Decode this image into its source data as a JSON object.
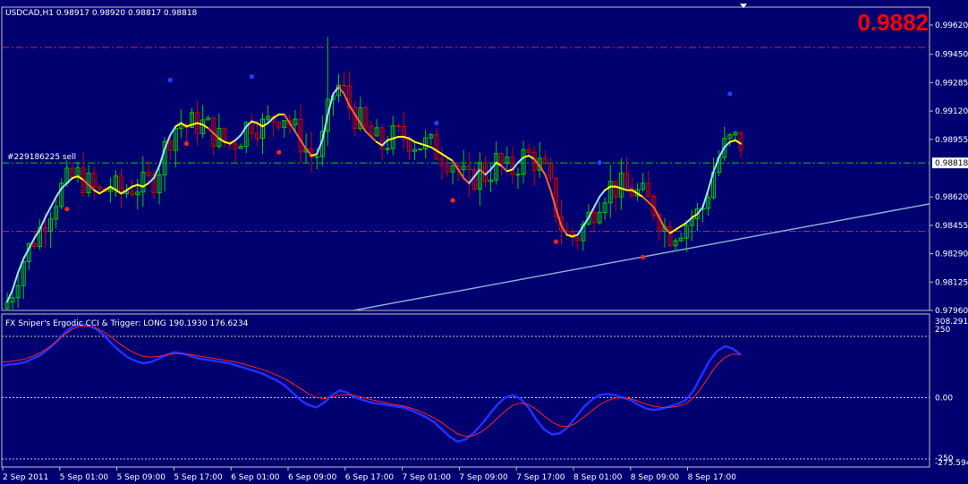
{
  "main": {
    "header": "USDCAD,H1  0.98917 0.98920 0.98817 0.98818",
    "big_price": "0.9882",
    "order_label": "#229186225 sell",
    "current_price_tag": "0.98818"
  },
  "indicator": {
    "header": "FX Sniper's Ergodic CCI & Trigger: LONG 190.1930 176.6234"
  },
  "colors": {
    "background": "#000070",
    "bull_candle": "#00cc00",
    "bear_candle": "#cc0000",
    "ma_up": "#9fe0ff",
    "ma_flat": "#ffff00",
    "ma_down": "#ff6030",
    "red_level": "#e02020",
    "green_level": "#00cc00",
    "trend_line": "#8aa9d6",
    "cci": "#2030ff",
    "trigger": "#ff2020"
  },
  "chart_data": [
    {
      "type": "candlestick",
      "title": "USDCAD,H1",
      "y_ticks": [
        "0.99620",
        "0.99450",
        "0.99285",
        "0.99120",
        "0.98955",
        "0.98818",
        "0.98620",
        "0.98455",
        "0.98290",
        "0.98125",
        "0.97960"
      ],
      "ylim": [
        0.9796,
        0.9975
      ],
      "x_ticks": [
        "2 Sep 2011",
        "5 Sep 01:00",
        "5 Sep 09:00",
        "5 Sep 17:00",
        "6 Sep 01:00",
        "6 Sep 09:00",
        "6 Sep 17:00",
        "7 Sep 01:00",
        "7 Sep 09:00",
        "7 Sep 17:00",
        "8 Sep 01:00",
        "8 Sep 09:00",
        "8 Sep 17:00"
      ],
      "levels": {
        "red": [
          0.9949,
          0.9842
        ],
        "green": 0.98818
      },
      "trend_line": {
        "from": 0.9796,
        "to": 0.9858
      },
      "bars": 136,
      "series": [
        {
          "values": [
            0.9801,
            0.9808,
            0.9818,
            0.9826,
            0.9832,
            0.9838,
            0.9843,
            0.985,
            0.9856,
            0.9862,
            0.9867,
            0.987,
            0.9873,
            0.9874,
            0.9872,
            0.9869,
            0.9866,
            0.9864,
            0.9866,
            0.9868,
            0.9866,
            0.9864,
            0.9866,
            0.9868,
            0.9869,
            0.9868,
            0.987,
            0.9873,
            0.988,
            0.989,
            0.9898,
            0.9903,
            0.9905,
            0.9903,
            0.9904,
            0.9905,
            0.9904,
            0.9902,
            0.9899,
            0.9896,
            0.9894,
            0.9893,
            0.9895,
            0.9898,
            0.9903,
            0.9906,
            0.9905,
            0.9903,
            0.9905,
            0.9908,
            0.991,
            0.991,
            0.9905,
            0.99,
            0.9895,
            0.989,
            0.9886,
            0.9887,
            0.9895,
            0.991,
            0.9922,
            0.9926,
            0.9922,
            0.9915,
            0.991,
            0.9905,
            0.99,
            0.9897,
            0.9894,
            0.9892,
            0.9895,
            0.9896,
            0.9897,
            0.9897,
            0.9896,
            0.9894,
            0.9893,
            0.9892,
            0.9891,
            0.9889,
            0.9887,
            0.9885,
            0.9883,
            0.9878,
            0.9873,
            0.987,
            0.9874,
            0.9878,
            0.9875,
            0.9878,
            0.9882,
            0.988,
            0.9877,
            0.9878,
            0.9882,
            0.9885,
            0.9886,
            0.9884,
            0.988,
            0.9875,
            0.9866,
            0.9855,
            0.9845,
            0.984,
            0.9839,
            0.984,
            0.9845,
            0.985,
            0.9856,
            0.9862,
            0.9866,
            0.9868,
            0.9868,
            0.9867,
            0.9866,
            0.9866,
            0.9864,
            0.9862,
            0.9859,
            0.9856,
            0.985,
            0.9844,
            0.9841,
            0.9843,
            0.9845,
            0.9847,
            0.985,
            0.9852,
            0.9856,
            0.9866,
            0.9877,
            0.9885,
            0.9891,
            0.9894,
            0.9895,
            0.9893
          ]
        }
      ],
      "signals": [
        {
          "bar": 11,
          "type": "sell",
          "value": 0.9855
        },
        {
          "bar": 30,
          "type": "buy",
          "value": 0.993
        },
        {
          "bar": 33,
          "type": "sell",
          "value": 0.9893
        },
        {
          "bar": 45,
          "type": "buy",
          "value": 0.9932
        },
        {
          "bar": 50,
          "type": "sell",
          "value": 0.9888
        },
        {
          "bar": 79,
          "type": "buy",
          "value": 0.9905
        },
        {
          "bar": 82,
          "type": "sell",
          "value": 0.986
        },
        {
          "bar": 101,
          "type": "sell",
          "value": 0.9836
        },
        {
          "bar": 109,
          "type": "buy",
          "value": 0.9882
        },
        {
          "bar": 117,
          "type": "sell",
          "value": 0.9827
        },
        {
          "bar": 133,
          "type": "buy",
          "value": 0.9922
        }
      ]
    },
    {
      "type": "line",
      "title": "FX Sniper's Ergodic CCI & Trigger: LONG 190.1930 176.6234",
      "y_ticks": [
        "308.291",
        "250",
        "0.00",
        "-250",
        "-275.594"
      ],
      "ylim": [
        -275.594,
        308.291
      ],
      "levels": [
        250,
        0,
        -250
      ],
      "series": [
        {
          "name": "Ergodic CCI",
          "values": [
            130,
            135,
            138,
            145,
            160,
            175,
            200,
            230,
            265,
            290,
            300,
            295,
            280,
            255,
            220,
            190,
            165,
            150,
            140,
            145,
            160,
            175,
            185,
            180,
            170,
            160,
            155,
            150,
            145,
            140,
            130,
            120,
            110,
            100,
            85,
            70,
            50,
            20,
            -10,
            -30,
            -40,
            -20,
            10,
            30,
            20,
            0,
            -10,
            -20,
            -25,
            -30,
            -35,
            -40,
            -50,
            -65,
            -80,
            -100,
            -130,
            -160,
            -180,
            -170,
            -145,
            -110,
            -70,
            -30,
            0,
            10,
            -5,
            -40,
            -90,
            -130,
            -150,
            -145,
            -120,
            -80,
            -40,
            -10,
            10,
            15,
            10,
            0,
            -10,
            -30,
            -45,
            -50,
            -45,
            -35,
            -25,
            -10,
            30,
            90,
            150,
            190,
            210,
            200,
            175
          ]
        },
        {
          "name": "Trigger",
          "values": [
            145,
            148,
            152,
            158,
            170,
            185,
            205,
            230,
            258,
            280,
            292,
            292,
            284,
            268,
            245,
            220,
            198,
            180,
            168,
            165,
            168,
            174,
            180,
            180,
            176,
            170,
            165,
            160,
            155,
            150,
            143,
            135,
            126,
            116,
            105,
            92,
            77,
            58,
            36,
            16,
            2,
            -4,
            2,
            10,
            12,
            8,
            0,
            -8,
            -15,
            -22,
            -28,
            -34,
            -42,
            -53,
            -67,
            -83,
            -103,
            -126,
            -148,
            -158,
            -155,
            -140,
            -115,
            -85,
            -55,
            -32,
            -22,
            -28,
            -48,
            -75,
            -100,
            -115,
            -118,
            -105,
            -80,
            -55,
            -30,
            -12,
            -2,
            0,
            -5,
            -15,
            -27,
            -36,
            -40,
            -40,
            -35,
            -25,
            0,
            40,
            90,
            135,
            165,
            178,
            176
          ]
        }
      ]
    }
  ]
}
